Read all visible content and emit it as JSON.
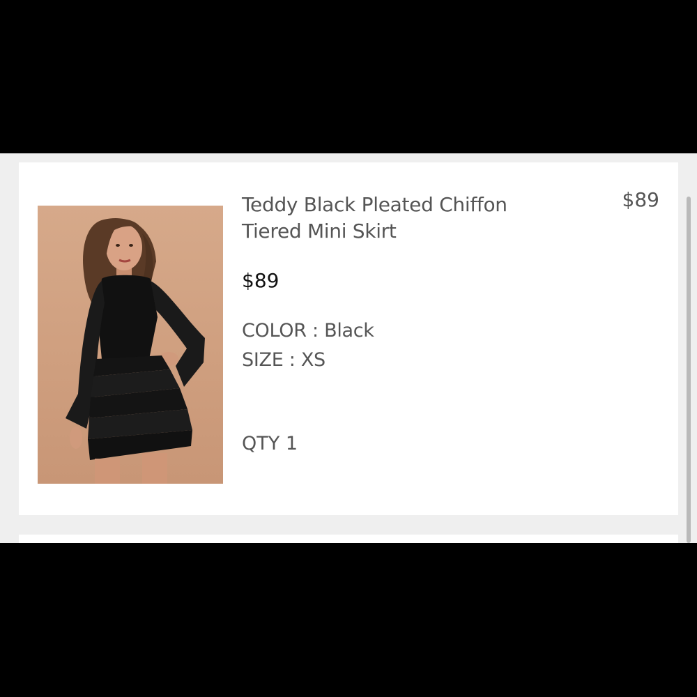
{
  "cart_item": {
    "title_line1": "Teddy Black Pleated Chiffon",
    "title_line2": "Tiered Mini Skirt",
    "line_total": "$89",
    "unit_price": "$89",
    "color_label": "COLOR",
    "color_value": "Black",
    "size_label": "SIZE",
    "size_value": "XS",
    "qty_label": "QTY",
    "qty_value": "1",
    "image": "model-wearing-black-tiered-mini-skirt"
  },
  "colors": {
    "page_background": "#efefef",
    "card_background": "#ffffff",
    "text_primary": "#111111",
    "text_secondary": "#555555",
    "image_background": "#d3a586"
  }
}
